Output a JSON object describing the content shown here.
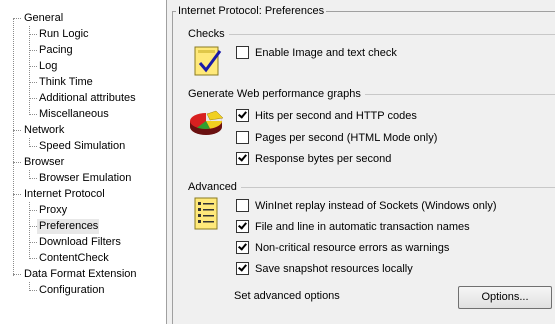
{
  "tree": {
    "groups": [
      {
        "label": "General",
        "children": [
          "Run Logic",
          "Pacing",
          "Log",
          "Think Time",
          "Additional attributes",
          "Miscellaneous"
        ]
      },
      {
        "label": "Network",
        "children": [
          "Speed Simulation"
        ]
      },
      {
        "label": "Browser",
        "children": [
          "Browser Emulation"
        ]
      },
      {
        "label": "Internet Protocol",
        "children": [
          "Proxy",
          "Preferences",
          "Download Filters",
          "ContentCheck"
        ]
      },
      {
        "label": "Data Format Extension",
        "children": [
          "Configuration"
        ]
      }
    ],
    "selected": "Preferences"
  },
  "panel": {
    "title": "Internet Protocol: Preferences",
    "sections": {
      "checks": {
        "title": "Checks",
        "icon": "checklist-icon",
        "options": [
          {
            "label": "Enable Image and text check",
            "checked": false
          }
        ]
      },
      "graphs": {
        "title": "Generate Web performance graphs",
        "icon": "pie-chart-icon",
        "options": [
          {
            "label": "Hits per second and HTTP codes",
            "checked": true
          },
          {
            "label": "Pages per second (HTML Mode only)",
            "checked": false
          },
          {
            "label": "Response bytes per second",
            "checked": true
          }
        ]
      },
      "advanced": {
        "title": "Advanced",
        "icon": "settings-list-icon",
        "options": [
          {
            "label": "WinInet replay instead of Sockets (Windows only)",
            "checked": false
          },
          {
            "label": "File and line in automatic transaction names",
            "checked": true
          },
          {
            "label": "Non-critical resource errors as warnings",
            "checked": true
          },
          {
            "label": "Save snapshot resources locally",
            "checked": true
          }
        ],
        "set_label": "Set advanced options",
        "button_label": "Options..."
      }
    }
  },
  "colors": {
    "background": "#f0f0f0",
    "tree_background": "#ffffff",
    "selection": "#e8e8e8"
  }
}
